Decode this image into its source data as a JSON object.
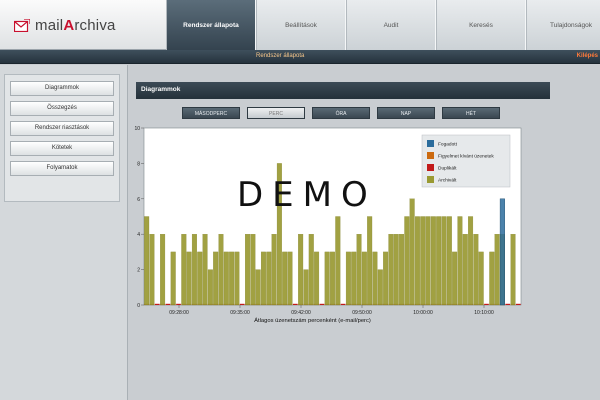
{
  "app": {
    "logo_main": "mail",
    "logo_accent": "A",
    "logo_rest": "rchiva"
  },
  "nav": {
    "tabs": [
      "Rendszer állapota",
      "Beállítások",
      "Audit",
      "Keresés",
      "Tulajdonságok"
    ],
    "active_index": 0
  },
  "subbar": {
    "title": "Rendszer állapota",
    "logout": "Kilépés"
  },
  "sidebar": {
    "items": [
      "Diagrammok",
      "Összegzés",
      "Rendszer riasztások",
      "Kötetek",
      "Folyamatok"
    ]
  },
  "panel": {
    "title": "Diagrammok"
  },
  "periods": {
    "items": [
      "MÁSODPERC",
      "PERC",
      "ÓRA",
      "NAP",
      "HÉT"
    ],
    "active_index": 1
  },
  "watermark": "DEMO",
  "colors": {
    "archived": "#9a9a32",
    "received": "#2b6c9c",
    "flagged": "#cc6a10",
    "duplicate": "#c21a1a"
  },
  "chart_data": {
    "type": "bar",
    "xlabel": "Átlagos üzenetszám percenként (e-mail/perc)",
    "ylabel": "",
    "ylim": [
      0,
      10
    ],
    "yticks": [
      0,
      2,
      4,
      6,
      8,
      10
    ],
    "xtick_labels": [
      "09:28:00",
      "09:35:00",
      "09:42:00",
      "09:50:00",
      "10:00:00",
      "10:10:00"
    ],
    "legend_position": "top-right",
    "series": [
      {
        "name": "Fogadott",
        "color": "#2b6c9c",
        "values": [
          0,
          0,
          0,
          0,
          0,
          0,
          0,
          0,
          0,
          0,
          0,
          0,
          0,
          0,
          0,
          0,
          0,
          0,
          0,
          0,
          0,
          0,
          0,
          0,
          0,
          0,
          0,
          0,
          0,
          0,
          0,
          0,
          0,
          0,
          0,
          0,
          0,
          0,
          0,
          0,
          0,
          0,
          0,
          0,
          0,
          0,
          0,
          0,
          0,
          0,
          0,
          0,
          0,
          0,
          0,
          0,
          0,
          0,
          0,
          0,
          0,
          0,
          0,
          0,
          0,
          0,
          0,
          6,
          0,
          0,
          0,
          0,
          0,
          0,
          0,
          0,
          0,
          0,
          0,
          0,
          0
        ]
      },
      {
        "name": "Figyelmet kívánt üzenetek",
        "color": "#cc6a10",
        "values": []
      },
      {
        "name": "Duplikált",
        "color": "#c21a1a",
        "values": []
      },
      {
        "name": "Archivált",
        "color": "#9a9a32",
        "values": [
          5,
          4,
          0,
          4,
          0,
          3,
          0,
          4,
          3,
          4,
          3,
          4,
          2,
          3,
          4,
          3,
          3,
          3,
          0,
          4,
          4,
          2,
          3,
          3,
          4,
          8,
          3,
          3,
          0,
          4,
          2,
          4,
          3,
          0,
          3,
          3,
          5,
          0,
          3,
          3,
          4,
          3,
          5,
          3,
          2,
          3,
          4,
          4,
          4,
          5,
          6,
          5,
          5,
          5,
          5,
          5,
          5,
          5,
          3,
          5,
          4,
          5,
          4,
          3,
          0,
          3,
          4,
          4,
          0,
          4,
          0
        ]
      }
    ]
  }
}
